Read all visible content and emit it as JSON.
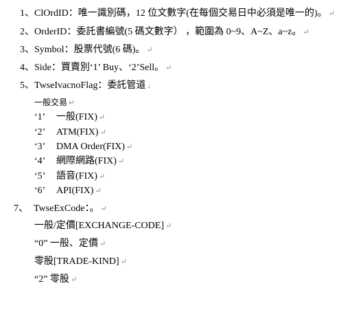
{
  "items": [
    {
      "num": "1",
      "sep": "、",
      "text": "ClOrdID：唯一識別碼，12 位文數字(在每個交易日中必須是唯一的)。",
      "mark": "↵"
    },
    {
      "num": "2",
      "sep": "、",
      "text": "OrderID：委託書編號(5 碼文數字） ，範圍為 0~9、A~Z、a~z。",
      "mark": "↵"
    },
    {
      "num": "3",
      "sep": "、",
      "text": "Symbol：股票代號(6 碼)。",
      "mark": "↵"
    },
    {
      "num": "4",
      "sep": "、",
      "text": "Side：買賣別‘1’ Buy、‘2’Sell。",
      "mark": "↵"
    },
    {
      "num": "5",
      "sep": "、",
      "text": "TwseIvacnoFlag：委託管道",
      "mark": "↓"
    }
  ],
  "flag_heading": {
    "text": "一般交易",
    "mark": "↵"
  },
  "flag_options": [
    {
      "code": "‘1’",
      "label": "一般(FIX)",
      "mark": "↵"
    },
    {
      "code": "‘2’",
      "label": "ATM(FIX)",
      "mark": "↵"
    },
    {
      "code": "‘3’",
      "label": "DMA Order(FIX)",
      "mark": "↵"
    },
    {
      "code": "‘4’",
      "label": "網際網路(FIX)",
      "mark": "↵"
    },
    {
      "code": "‘5’",
      "label": "語音(FIX)",
      "mark": "↵"
    },
    {
      "code": "‘6’",
      "label": "API(FIX)",
      "mark": "↵"
    }
  ],
  "item7": {
    "num": "7、",
    "text": "TwseExCode：。",
    "mark": "↵"
  },
  "excode_lines": [
    {
      "text": "一般/定價[EXCHANGE-CODE]",
      "mark": "↵"
    },
    {
      "text": "“0” 一般、定價",
      "mark": "↵"
    },
    {
      "text": "零股[TRADE-KIND]",
      "mark": "↵"
    },
    {
      "text": "“2” 零股",
      "mark": "↵"
    }
  ]
}
